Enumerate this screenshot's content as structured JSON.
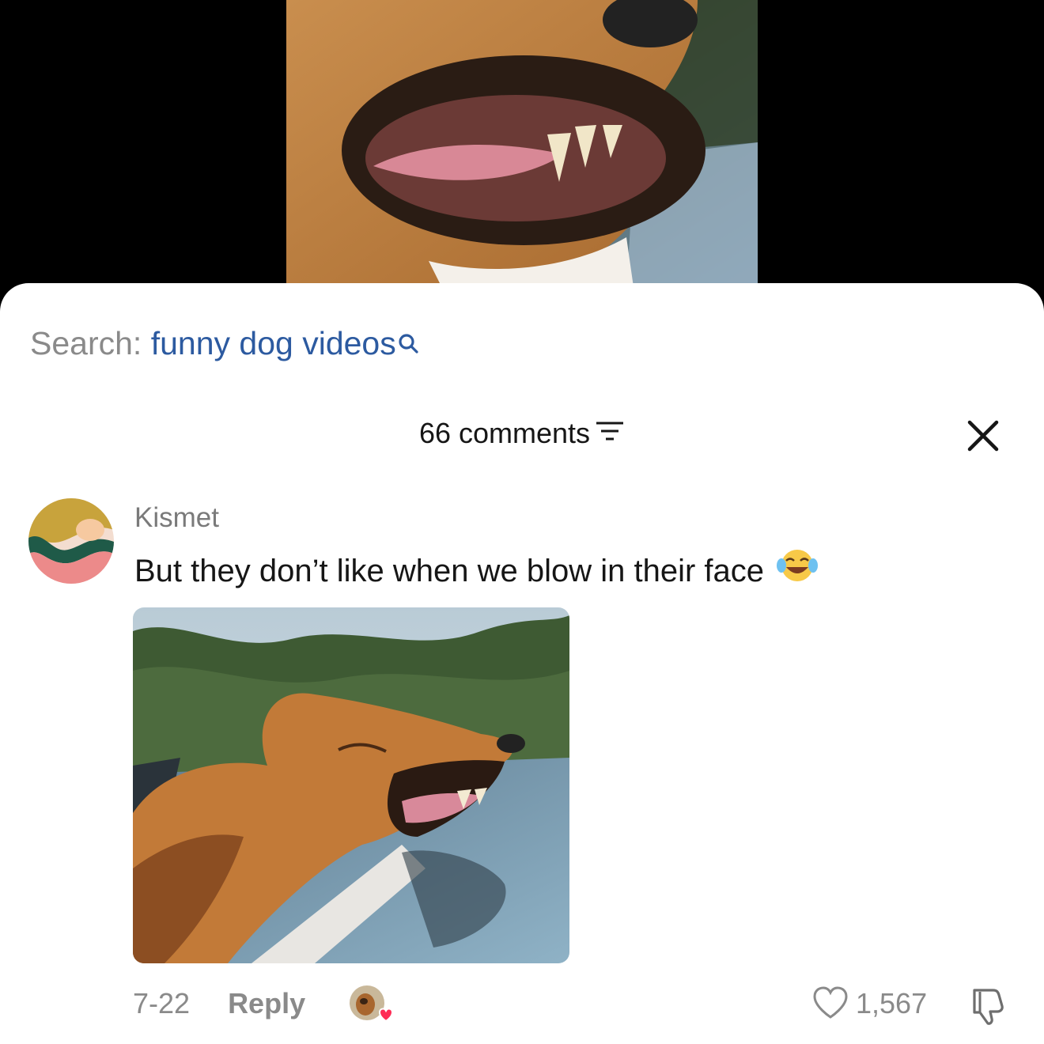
{
  "search": {
    "label": "Search:",
    "term": "funny dog videos"
  },
  "header": {
    "comments_count": "66 comments"
  },
  "comment": {
    "username": "Kismet",
    "text": "But they don’t like when we blow in their face",
    "emoji": "face-with-tears-of-joy",
    "date": "7-22",
    "reply_label": "Reply",
    "like_count": "1,567"
  },
  "colors": {
    "search_term": "#2c5aa0",
    "muted_text": "#8a8a8a",
    "heart_badge": "#fe2c55"
  }
}
